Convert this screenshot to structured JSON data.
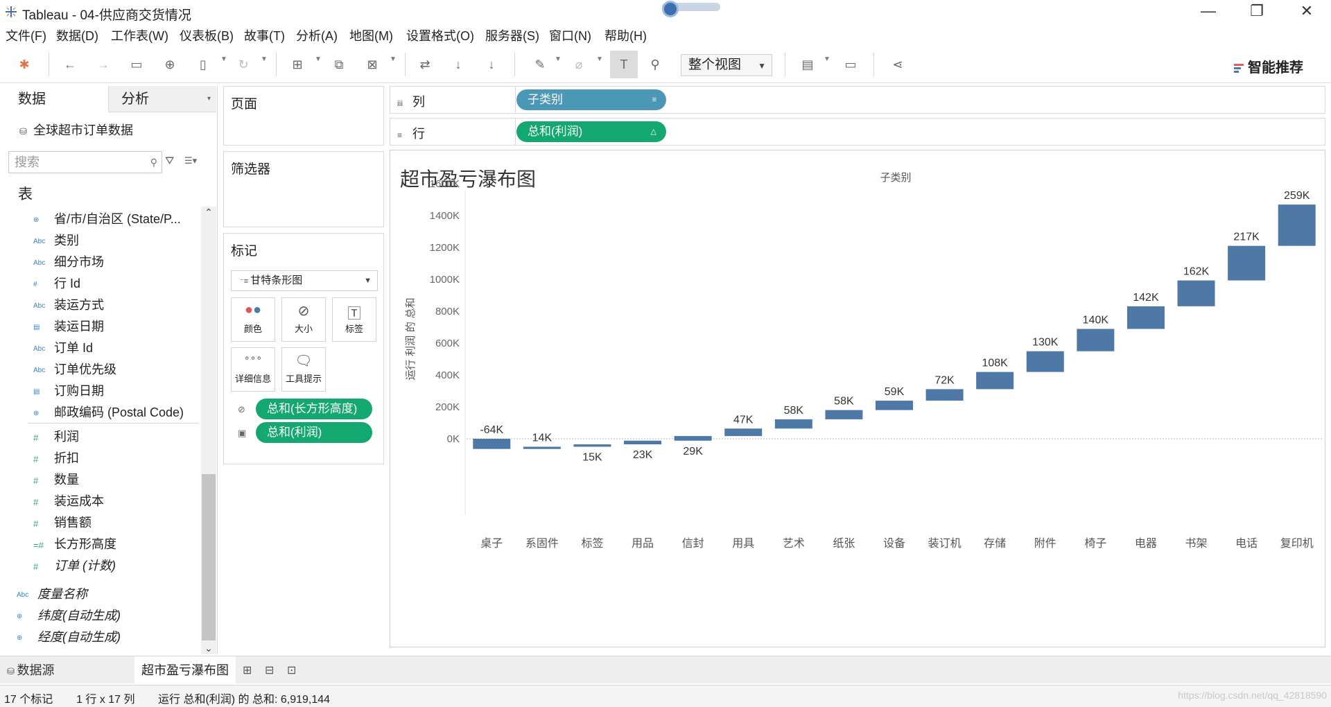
{
  "window": {
    "title": "Tableau - 04-供应商交货情况",
    "minimize": "—",
    "restore": "❐",
    "close": "✕"
  },
  "menu": [
    "文件(F)",
    "数据(D)",
    "工作表(W)",
    "仪表板(B)",
    "故事(T)",
    "分析(A)",
    "地图(M)",
    "设置格式(O)",
    "服务器(S)",
    "窗口(N)",
    "帮助(H)"
  ],
  "toolbar": {
    "view_mode": "整个视图",
    "smart_recommend": "智能推荐"
  },
  "data_pane": {
    "tab_data": "数据",
    "tab_analysis": "分析",
    "datasource": "全球超市订单数据",
    "search_placeholder": "搜索",
    "tables_label": "表",
    "dimensions": [
      {
        "icon": "globe-icon",
        "label": "省/市/自治区 (State/P..."
      },
      {
        "icon": "abc-icon",
        "label": "类别"
      },
      {
        "icon": "abc-icon",
        "label": "细分市场"
      },
      {
        "icon": "hash-icon",
        "label": "行 Id"
      },
      {
        "icon": "abc-icon",
        "label": "装运方式"
      },
      {
        "icon": "calendar-icon",
        "label": "装运日期"
      },
      {
        "icon": "abc-icon",
        "label": "订单 Id"
      },
      {
        "icon": "abc-icon",
        "label": "订单优先级"
      },
      {
        "icon": "calendar-icon",
        "label": "订购日期"
      },
      {
        "icon": "globe-icon",
        "label": "邮政编码 (Postal Code)"
      }
    ],
    "measures": [
      {
        "icon": "hash-icon",
        "label": "利润"
      },
      {
        "icon": "hash-icon",
        "label": "折扣"
      },
      {
        "icon": "hash-icon",
        "label": "数量"
      },
      {
        "icon": "hash-icon",
        "label": "装运成本"
      },
      {
        "icon": "hash-icon",
        "label": "销售额"
      },
      {
        "icon": "calc-hash-icon",
        "label": "长方形高度"
      },
      {
        "icon": "hash-icon",
        "label": "订单 (计数)"
      }
    ],
    "extra": [
      {
        "icon": "abc-icon",
        "label": "度量名称"
      },
      {
        "icon": "globe-icon",
        "label": "纬度(自动生成)"
      },
      {
        "icon": "globe-icon",
        "label": "经度(自动生成)"
      }
    ]
  },
  "cards": {
    "pages": "页面",
    "filters": "筛选器",
    "marks": "标记",
    "mark_type": "甘特条形图",
    "buttons": [
      {
        "icon": "color-icon",
        "label": "颜色"
      },
      {
        "icon": "size-icon",
        "label": "大小"
      },
      {
        "icon": "label-icon",
        "label": "标签"
      },
      {
        "icon": "detail-icon",
        "label": "详细信息"
      },
      {
        "icon": "tooltip-icon",
        "label": "工具提示"
      }
    ],
    "pills": [
      "总和(长方形高度)",
      "总和(利润)"
    ]
  },
  "shelves": {
    "columns_label": "列",
    "columns_pill": "子类别",
    "rows_label": "行",
    "rows_pill": "总和(利润)"
  },
  "viz": {
    "title": "超市盈亏瀑布图",
    "header": "子类别",
    "ylabel": "运行 利润 的 总和"
  },
  "chart_data": {
    "type": "bar",
    "subtype": "waterfall",
    "title": "超市盈亏瀑布图",
    "xlabel": "子类别",
    "ylabel": "运行 利润 的 总和",
    "ylim": [
      -100000,
      1620000
    ],
    "yticks": [
      0,
      200000,
      400000,
      600000,
      800000,
      1000000,
      1200000,
      1400000,
      1600000
    ],
    "ytick_labels": [
      "0K",
      "200K",
      "400K",
      "600K",
      "800K",
      "1000K",
      "1200K",
      "1400K",
      "1600K"
    ],
    "categories": [
      "桌子",
      "系固件",
      "标签",
      "用品",
      "信封",
      "用具",
      "艺术",
      "纸张",
      "设备",
      "装订机",
      "存储",
      "附件",
      "椅子",
      "电器",
      "书架",
      "电话",
      "复印机"
    ],
    "values": [
      -64000,
      14000,
      15000,
      23000,
      29000,
      47000,
      58000,
      58000,
      59000,
      72000,
      108000,
      130000,
      140000,
      142000,
      162000,
      217000,
      259000
    ],
    "data_labels": [
      "-64K",
      "14K",
      "15K",
      "23K",
      "29K",
      "47K",
      "58K",
      "58K",
      "59K",
      "72K",
      "108K",
      "130K",
      "140K",
      "142K",
      "162K",
      "217K",
      "259K"
    ],
    "color": "#4e79a7",
    "grid": false,
    "zero_line": true
  },
  "sheet_tabs": {
    "datasource": "数据源",
    "active": "超市盈亏瀑布图"
  },
  "status": {
    "marks": "17 个标记",
    "dims": "1 行 x 17 列",
    "sum": "运行 总和(利润) 的 总和: 6,919,144"
  },
  "watermark": "https://blog.csdn.net/qq_42818590"
}
